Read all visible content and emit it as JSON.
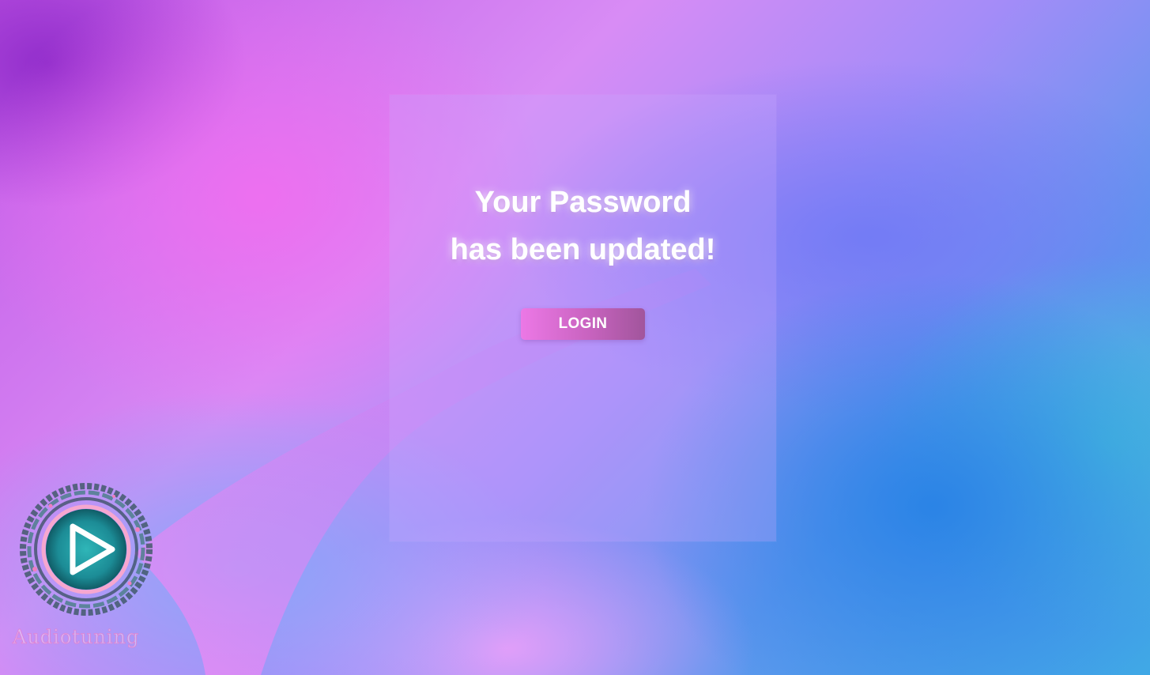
{
  "message": {
    "line1": "Your Password",
    "line2": "has been updated!"
  },
  "login_button": {
    "label": "LOGIN"
  },
  "brand": {
    "logo_icon": "play-icon",
    "wordmark": "Audiotuning"
  },
  "colors": {
    "button_start": "#ec78e6",
    "button_end": "#a1559c",
    "text": "#ffffff"
  }
}
